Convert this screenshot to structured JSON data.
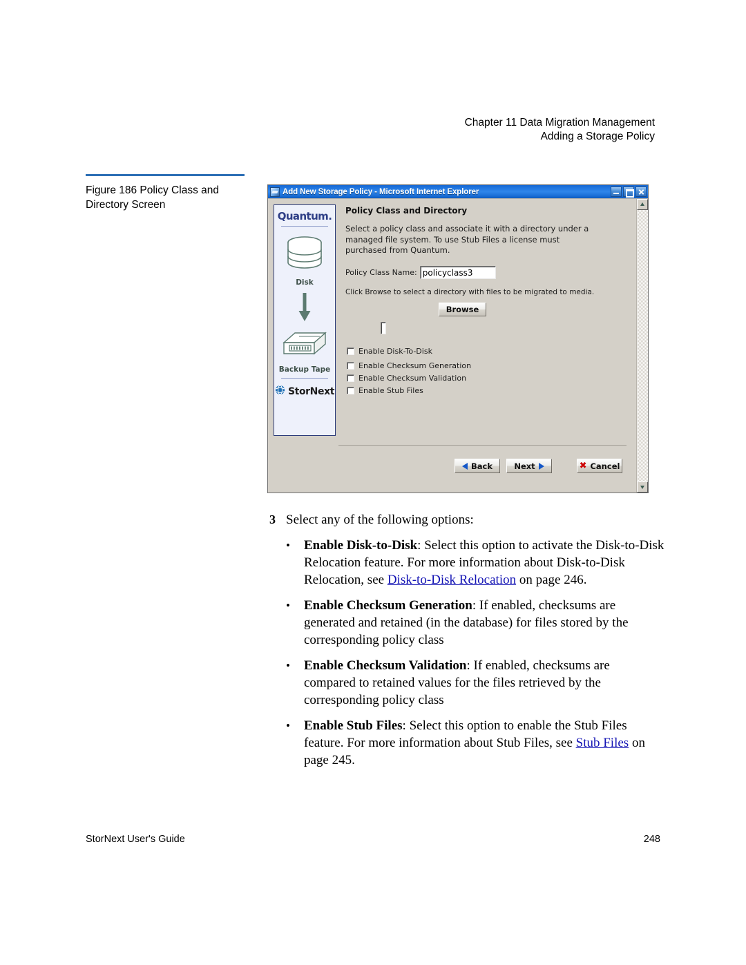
{
  "page_header": {
    "line1": "Chapter 11  Data Migration Management",
    "line2": "Adding a Storage Policy"
  },
  "figure": {
    "caption": "Figure 186  Policy Class and Directory Screen",
    "rule_color": "#2d6fb5"
  },
  "dialog": {
    "title": "Add New Storage Policy - Microsoft Internet Explorer",
    "window_buttons": {
      "minimize": "Minimize",
      "maximize": "Maximize",
      "close": "Close"
    },
    "sidebar": {
      "brand": "Quantum.",
      "disk_label": "Disk",
      "tape_label": "Backup Tape",
      "product": "StorNext"
    },
    "heading": "Policy Class and Directory",
    "description": "Select a policy class and associate it with a directory under a managed file system. To use Stub Files a license must purchased from Quantum.",
    "policy_class_name_label": "Policy Class Name:",
    "policy_class_name_value": "policyclass3",
    "browse_hint": "Click Browse to select a directory with files to be migrated to media.",
    "browse_label": "Browse",
    "directory_value": "",
    "checkboxes": [
      {
        "label": "Enable Disk-To-Disk",
        "checked": false
      },
      {
        "label": "Enable Checksum Generation",
        "checked": false
      },
      {
        "label": "Enable Checksum Validation",
        "checked": false
      },
      {
        "label": "Enable Stub Files",
        "checked": false
      }
    ],
    "buttons": {
      "back": "Back",
      "next": "Next",
      "cancel": "Cancel"
    }
  },
  "body": {
    "step_number": "3",
    "step_text": "Select any of the following options:",
    "bullet_char": "•",
    "bullets": [
      {
        "term": "Enable Disk-to-Disk",
        "text_before": ": Select this option to activate the Disk-to-Disk Relocation feature. For more information about Disk-to-Disk Relocation, see ",
        "link": "Disk-to-Disk Relocation",
        "text_after": " on page  246."
      },
      {
        "term": "Enable Checksum Generation",
        "text_before": ": If enabled, checksums are generated and retained (in the database) for files stored by the corresponding policy class",
        "link": "",
        "text_after": ""
      },
      {
        "term": "Enable Checksum Validation",
        "text_before": ": If enabled, checksums are compared to retained values for the files retrieved by the corresponding policy class",
        "link": "",
        "text_after": ""
      },
      {
        "term": "Enable Stub Files",
        "text_before": ": Select this option to enable the Stub Files feature. For more information about Stub Files, see ",
        "link": "Stub Files",
        "text_after": " on page  245."
      }
    ]
  },
  "footer": {
    "left": "StorNext User's Guide",
    "right": "248"
  }
}
